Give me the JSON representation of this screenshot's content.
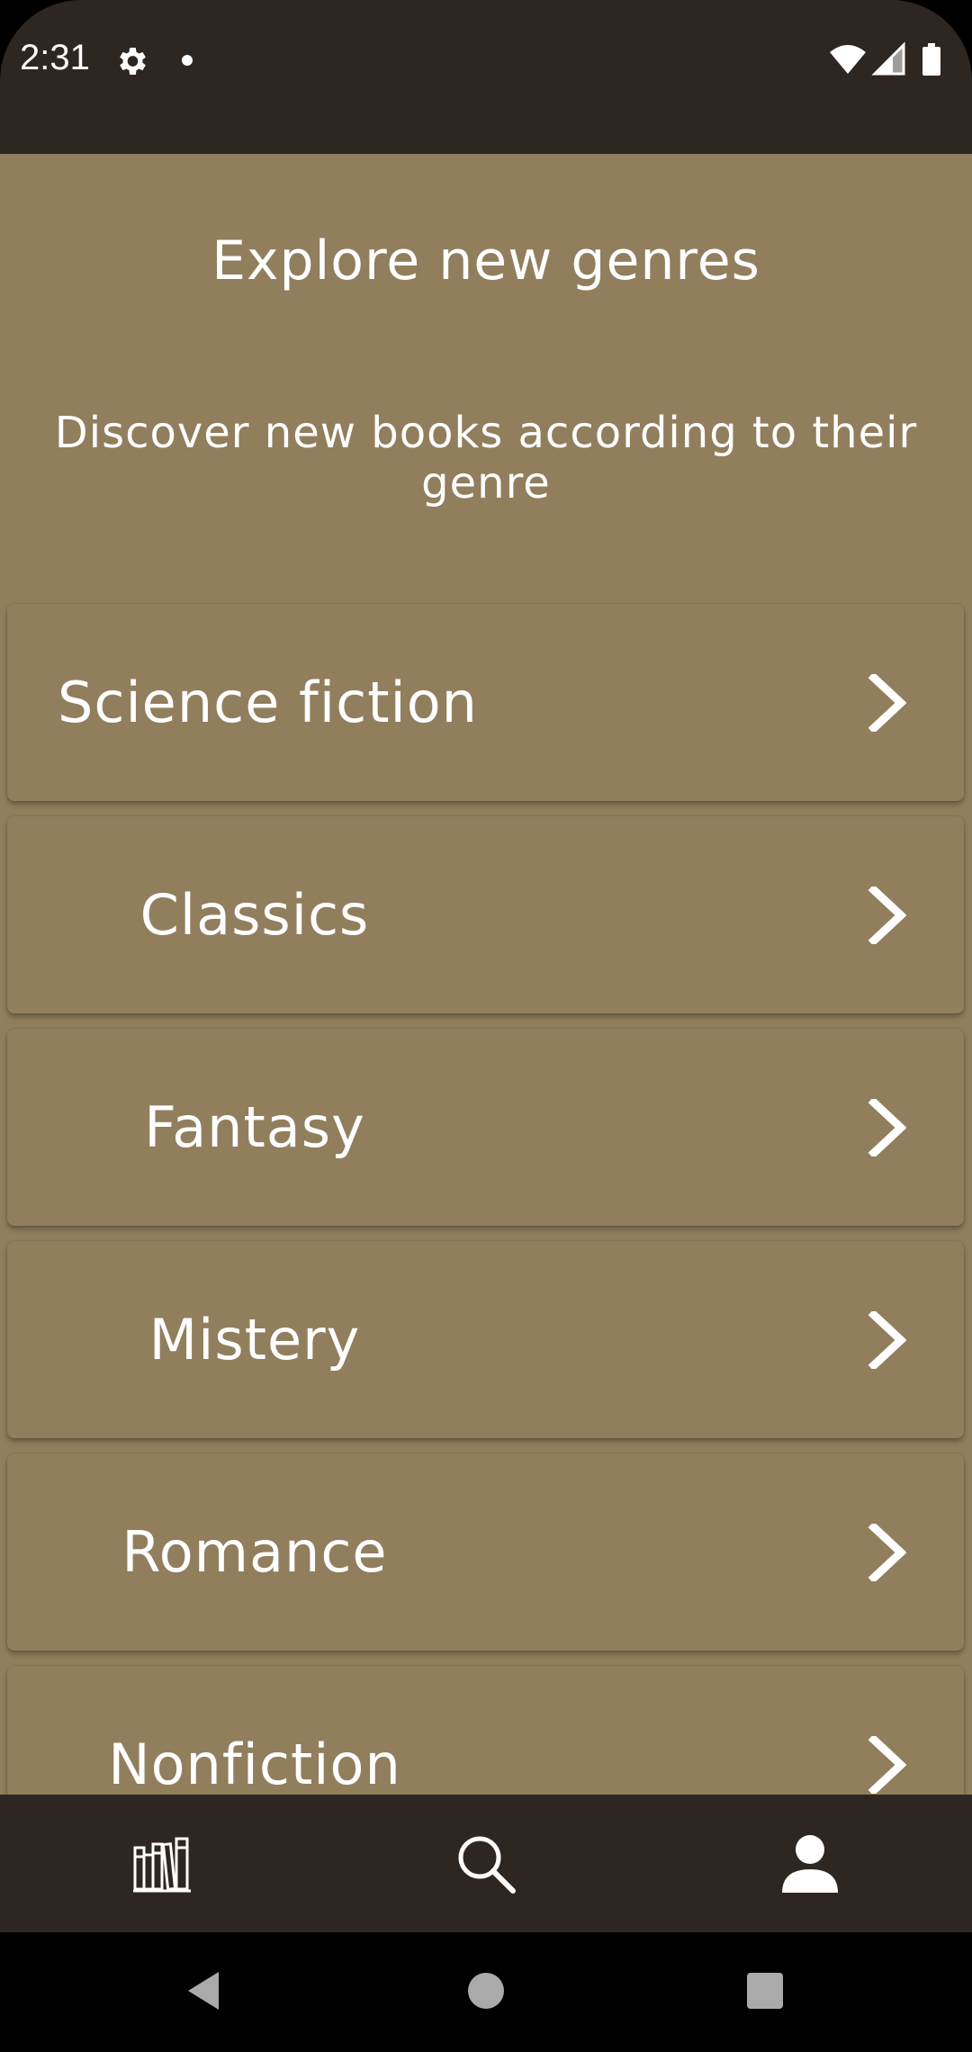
{
  "status_bar": {
    "time": "2:31",
    "icons": [
      "gear-icon",
      "notification-dot-icon",
      "wifi-icon",
      "signal-icon",
      "battery-icon"
    ]
  },
  "header": {
    "title": "Explore new genres",
    "subtitle": "Discover new books according to their genre"
  },
  "genres": [
    {
      "label": "Science fiction"
    },
    {
      "label": "Classics"
    },
    {
      "label": "Fantasy"
    },
    {
      "label": "Mistery"
    },
    {
      "label": "Romance"
    },
    {
      "label": "Nonfiction"
    }
  ],
  "bottom_nav": {
    "items": [
      {
        "icon": "library-icon"
      },
      {
        "icon": "search-icon"
      },
      {
        "icon": "profile-icon"
      }
    ]
  },
  "system_nav": {
    "buttons": [
      "back-icon",
      "home-icon",
      "recents-icon"
    ]
  },
  "colors": {
    "background": "#917e5d",
    "bar": "#2e2621",
    "text": "#ffffff"
  }
}
